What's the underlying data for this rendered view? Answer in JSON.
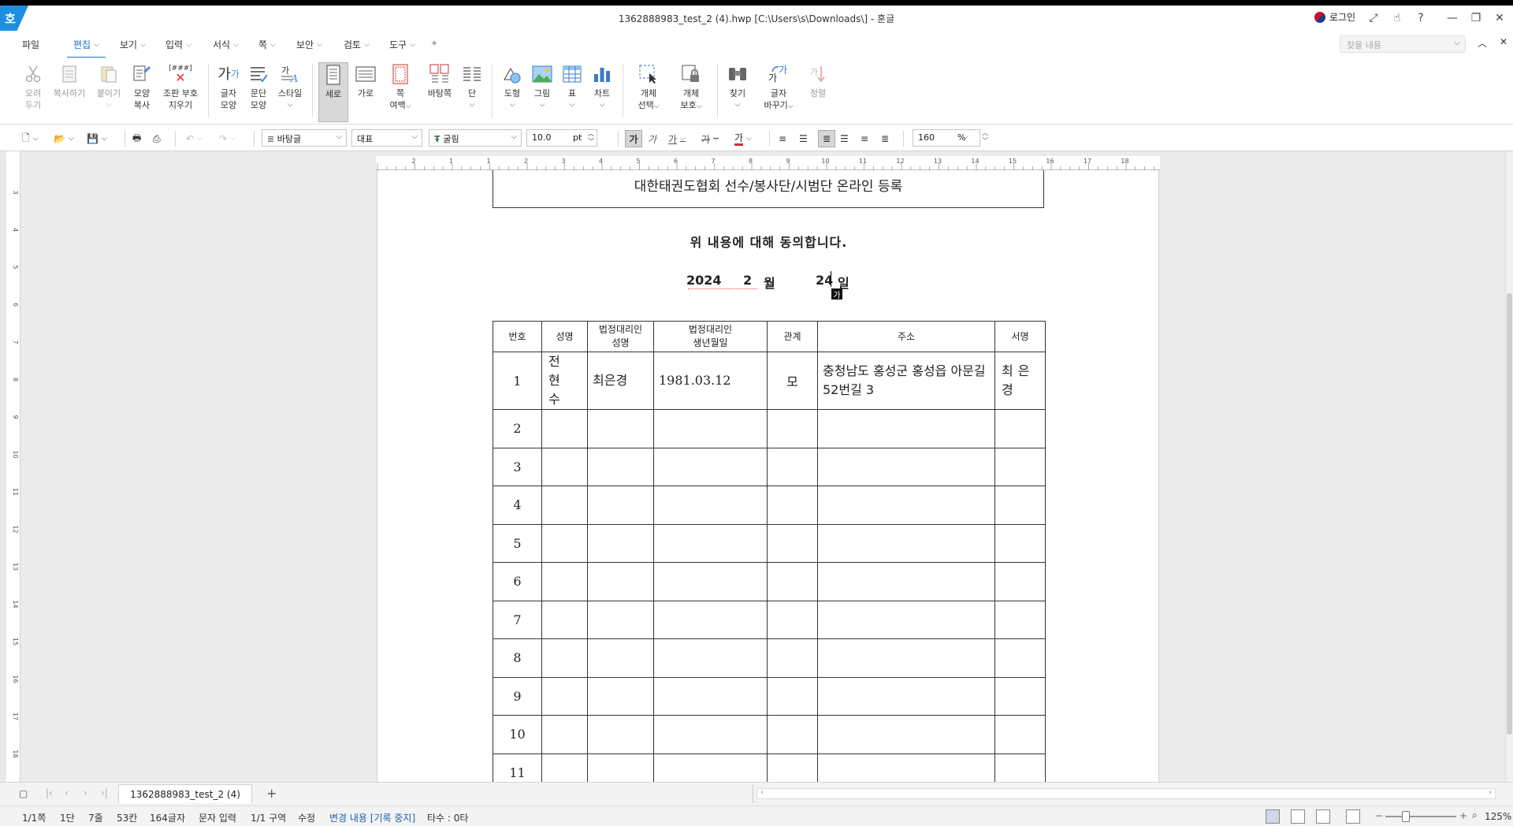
{
  "window": {
    "logo": "호",
    "title": "1362888983_test_2 (4).hwp [C:\\Users\\s\\Downloads\\] - 훈글",
    "login": "로그인"
  },
  "menu": {
    "file": "파일",
    "items": [
      "편집",
      "보기",
      "입력",
      "서식",
      "쪽",
      "보안",
      "검토",
      "도구"
    ],
    "search_placeholder": "찾을 내용"
  },
  "ribbon": {
    "cut": [
      "오려",
      "두기"
    ],
    "copy": "복사하기",
    "paste": "붙이기",
    "format_copy": [
      "모양",
      "복사"
    ],
    "clear_marks_icon_text": "[###]",
    "clear_marks": [
      "조판 부호",
      "지우기"
    ],
    "char_shape": [
      "글자",
      "모양"
    ],
    "para_shape": [
      "문단",
      "모양"
    ],
    "style": "스타일",
    "portrait": "세로",
    "landscape": "가로",
    "page_margin": [
      "쪽",
      "여백"
    ],
    "page_bg": "바탕쪽",
    "columns": "단",
    "shape": "도형",
    "picture": "그림",
    "table": "표",
    "chart": "차트",
    "obj_select": [
      "개체",
      "선택"
    ],
    "obj_protect": [
      "개체",
      "보호"
    ],
    "find": "찾기",
    "replace": [
      "글자",
      "바꾸기"
    ],
    "align": "정렬"
  },
  "format_bar": {
    "style": "바탕글",
    "lang": "대표",
    "font": "굴림",
    "size": "10.0",
    "unit": "pt",
    "bold": "가",
    "italic": "가",
    "underline": "가",
    "strike": "가",
    "font_color": "가",
    "zoom": "160",
    "zoom_unit": "%"
  },
  "ruler": {
    "h_marks": [
      "2",
      "1",
      "1",
      "2",
      "3",
      "4",
      "5",
      "6",
      "7",
      "8",
      "9",
      "10",
      "11",
      "12",
      "13",
      "14",
      "15",
      "16",
      "17",
      "18"
    ],
    "v_marks": [
      "3",
      "4",
      "5",
      "6",
      "7",
      "8",
      "9",
      "10",
      "11",
      "12",
      "13",
      "14",
      "15",
      "16",
      "17",
      "18"
    ]
  },
  "document": {
    "title": "대한태권도협회 선수/봉사단/시범단 온라인 등록",
    "agree": "위 내용에 대해 동의합니다.",
    "date": {
      "year": "2024",
      "month": "2",
      "month_label": "월",
      "day": "24",
      "day_label": "일"
    },
    "ime_badge": "가",
    "table": {
      "headers": [
        "번호",
        "성명",
        "법정대리인\n성명",
        "법정대리인\n생년월일",
        "관계",
        "주소",
        "서명"
      ],
      "rows": [
        [
          "1",
          "전현수",
          "최은경",
          "1981.03.12",
          "모",
          "충청남도 홍성군 홍성읍 아문길52번길 3",
          "최은경"
        ],
        [
          "2",
          "",
          "",
          "",
          "",
          "",
          ""
        ],
        [
          "3",
          "",
          "",
          "",
          "",
          "",
          ""
        ],
        [
          "4",
          "",
          "",
          "",
          "",
          "",
          ""
        ],
        [
          "5",
          "",
          "",
          "",
          "",
          "",
          ""
        ],
        [
          "6",
          "",
          "",
          "",
          "",
          "",
          ""
        ],
        [
          "7",
          "",
          "",
          "",
          "",
          "",
          ""
        ],
        [
          "8",
          "",
          "",
          "",
          "",
          "",
          ""
        ],
        [
          "9",
          "",
          "",
          "",
          "",
          "",
          ""
        ],
        [
          "10",
          "",
          "",
          "",
          "",
          "",
          ""
        ],
        [
          "11",
          "",
          "",
          "",
          "",
          "",
          ""
        ]
      ]
    }
  },
  "tabs": {
    "doc_tab": "1362888983_test_2 (4)",
    "add": "+"
  },
  "status": {
    "page": "1/1쪽",
    "col": "1단",
    "line": "7줄",
    "pos": "53칸",
    "chars": "164글자",
    "mode": "문자 입력",
    "section": "1/1 구역",
    "edit": "수정",
    "track": "변경 내용 [기록 중지]",
    "typing": "타수 : 0타",
    "zoom": "125%"
  }
}
